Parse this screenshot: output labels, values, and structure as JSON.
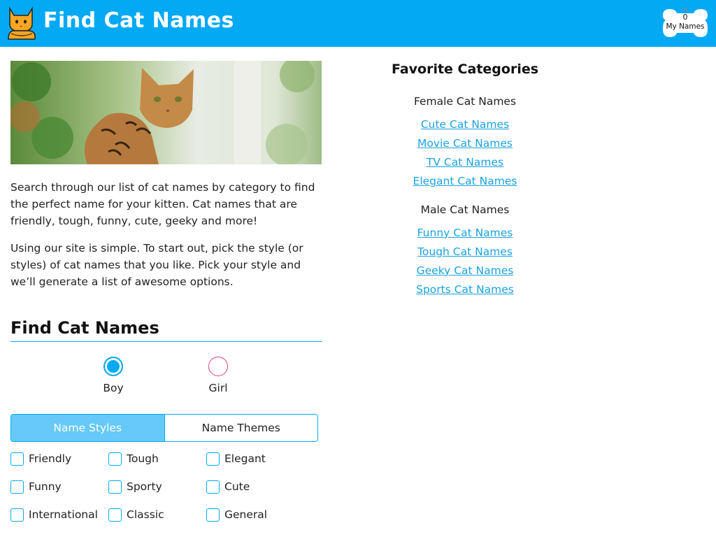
{
  "header": {
    "title": "Find Cat Names",
    "saved_count": "0",
    "saved_label": "My Names",
    "brand_color": "#04a9f4",
    "logo_icon": "cat-logo-icon",
    "saved_icon": "bone-icon"
  },
  "intro": {
    "paragraph1": "Search through our list of cat names by category to find the perfect name for your kitten. Cat names that are friendly, tough, funny, cute, geeky and more!",
    "paragraph2": "Using our site is simple. To start out, pick the style (or styles) of cat names that you like. Pick your style and we’ll generate a list of awesome options."
  },
  "finder": {
    "title": "Find Cat Names",
    "gender": {
      "boy": "Boy",
      "girl": "Girl",
      "selected": "Boy"
    },
    "tabs": {
      "styles": "Name Styles",
      "themes": "Name Themes",
      "active": "Name Styles"
    },
    "checkboxes": [
      "Friendly",
      "Tough",
      "Elegant",
      "Funny",
      "Sporty",
      "Cute",
      "International",
      "Classic",
      "General"
    ]
  },
  "favorites": {
    "title": "Favorite Categories",
    "female": {
      "heading": "Female Cat Names",
      "links": [
        "Cute Cat Names",
        "Movie Cat Names",
        "TV Cat Names",
        "Elegant Cat Names"
      ]
    },
    "male": {
      "heading": "Male Cat Names",
      "links": [
        "Funny Cat Names",
        "Tough Cat Names",
        "Geeky Cat Names",
        "Sports Cat Names"
      ]
    }
  }
}
